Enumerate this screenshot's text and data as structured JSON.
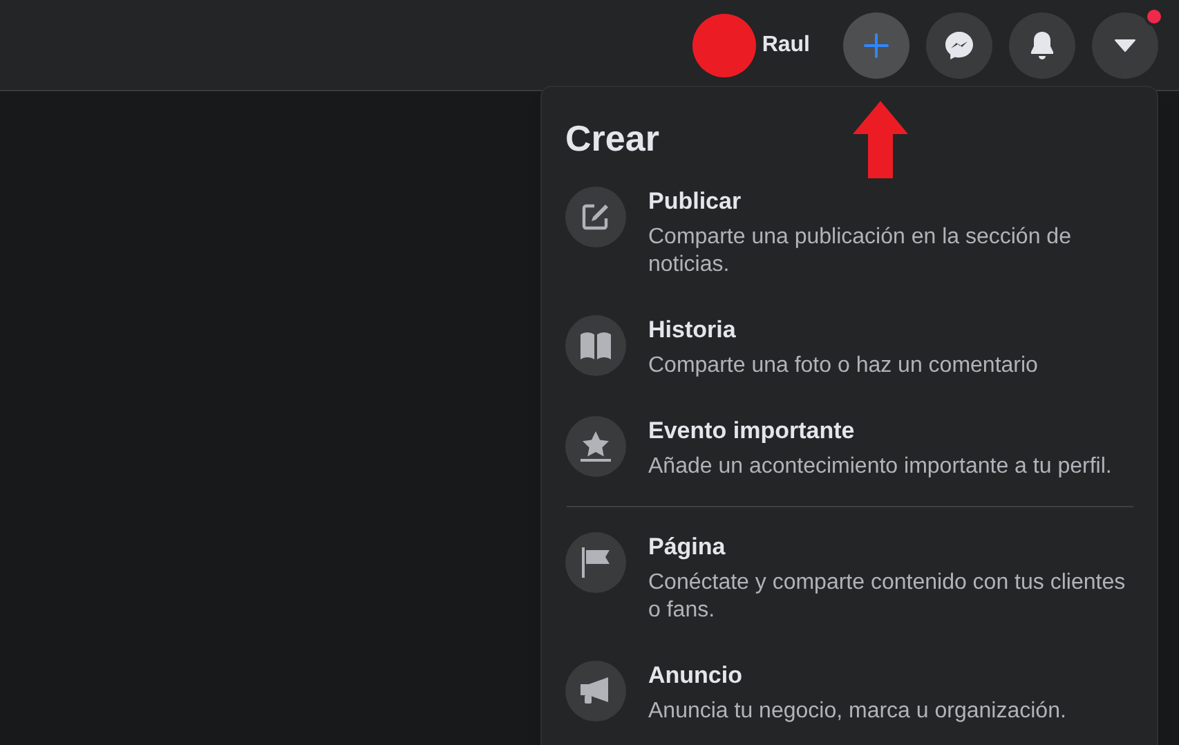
{
  "profile": {
    "name": "Raul"
  },
  "top_buttons": [
    {
      "kind": "create",
      "selected": true,
      "alert": false
    },
    {
      "kind": "messenger",
      "selected": false,
      "alert": false
    },
    {
      "kind": "notifications",
      "selected": false,
      "alert": false
    },
    {
      "kind": "account",
      "selected": false,
      "alert": true
    }
  ],
  "menu": {
    "title": "Crear",
    "sections": [
      {
        "items": [
          {
            "kind": "post",
            "label": "Publicar",
            "description": "Comparte una publicación en la sección de noticias."
          },
          {
            "kind": "story",
            "label": "Historia",
            "description": "Comparte una foto o haz un comentario"
          },
          {
            "kind": "event",
            "label": "Evento importante",
            "description": "Añade un acontecimiento importante a tu perfil."
          }
        ]
      },
      {
        "items": [
          {
            "kind": "page",
            "label": "Página",
            "description": "Conéctate y comparte contenido con tus clientes o fans."
          },
          {
            "kind": "ad",
            "label": "Anuncio",
            "description": "Anuncia tu negocio, marca u organización."
          }
        ]
      }
    ]
  }
}
